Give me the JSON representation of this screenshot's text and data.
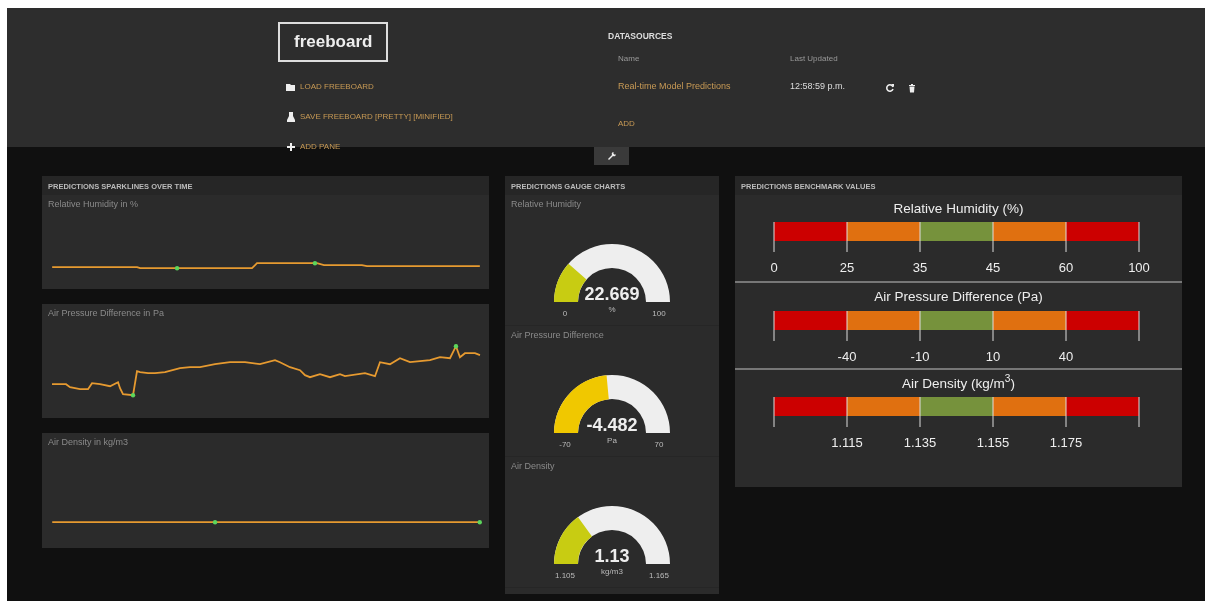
{
  "header": {
    "logo": "freeboard",
    "menu": [
      {
        "label": "LOAD FREEBOARD",
        "kind": "load"
      },
      {
        "label": "SAVE FREEBOARD [PRETTY] [MINIFIED]",
        "kind": "save"
      },
      {
        "label": "ADD PANE",
        "kind": "add"
      }
    ],
    "datasources": {
      "title": "DATASOURCES",
      "columns": [
        "Name",
        "Last Updated"
      ],
      "rows": [
        {
          "name": "Real-time Model Predictions",
          "last_updated": "12:58:59 p.m."
        }
      ],
      "add": "ADD"
    }
  },
  "sparkline_pane": {
    "title": "PREDICTIONS SPARKLINES OVER TIME",
    "widgets": [
      {
        "title": "Relative Humidity in %",
        "kind": "picture"
      },
      {
        "title": "Air Pressure Difference in Pa",
        "kind": "picture"
      },
      {
        "title": "Air Density in kg/m3",
        "kind": "picture"
      }
    ]
  },
  "gauge_pane": {
    "title": "PREDICTIONS GAUGE CHARTS",
    "widgets": [
      {
        "title": "Relative Humidity",
        "value": "22.669",
        "units": "%",
        "min": "0",
        "max": "100",
        "color": "#c8cc12"
      },
      {
        "title": "Air Pressure Difference",
        "value": "-4.482",
        "units": "Pa",
        "min": "-70",
        "max": "70",
        "color": "#f0c800"
      },
      {
        "title": "Air Density",
        "value": "1.13",
        "units": "kg/m3",
        "min": "1.105",
        "max": "1.165",
        "color": "#c8cc12"
      }
    ]
  },
  "benchmark_pane": {
    "title": "PREDICTIONS BENCHMARK VALUES",
    "bars": [
      {
        "title": "Relative Humidity (%)",
        "segments": [
          {
            "color": "#cc0000"
          },
          {
            "color": "#e07010"
          },
          {
            "color": "#76923c"
          },
          {
            "color": "#e07010"
          },
          {
            "color": "#cc0000"
          }
        ],
        "kind": "full",
        "ticks": [
          "0",
          "25",
          "35",
          "45",
          "60",
          "100"
        ]
      },
      {
        "title": "Air Pressure Difference (Pa)",
        "segments": [
          {
            "color": "#cc0000"
          },
          {
            "color": "#e07010"
          },
          {
            "color": "#76923c"
          },
          {
            "color": "#e07010"
          },
          {
            "color": "#cc0000"
          }
        ],
        "kind": "inner",
        "ticks": [
          "-40",
          "-10",
          "10",
          "40"
        ]
      },
      {
        "title": "Air Density (kg/m$^{3}$)",
        "segments": [
          {
            "color": "#cc0000"
          },
          {
            "color": "#e07010"
          },
          {
            "color": "#76923c"
          },
          {
            "color": "#e07010"
          },
          {
            "color": "#cc0000"
          }
        ],
        "kind": "inner",
        "ticks": [
          "1.115",
          "1.135",
          "1.155",
          "1.175"
        ]
      }
    ]
  }
}
